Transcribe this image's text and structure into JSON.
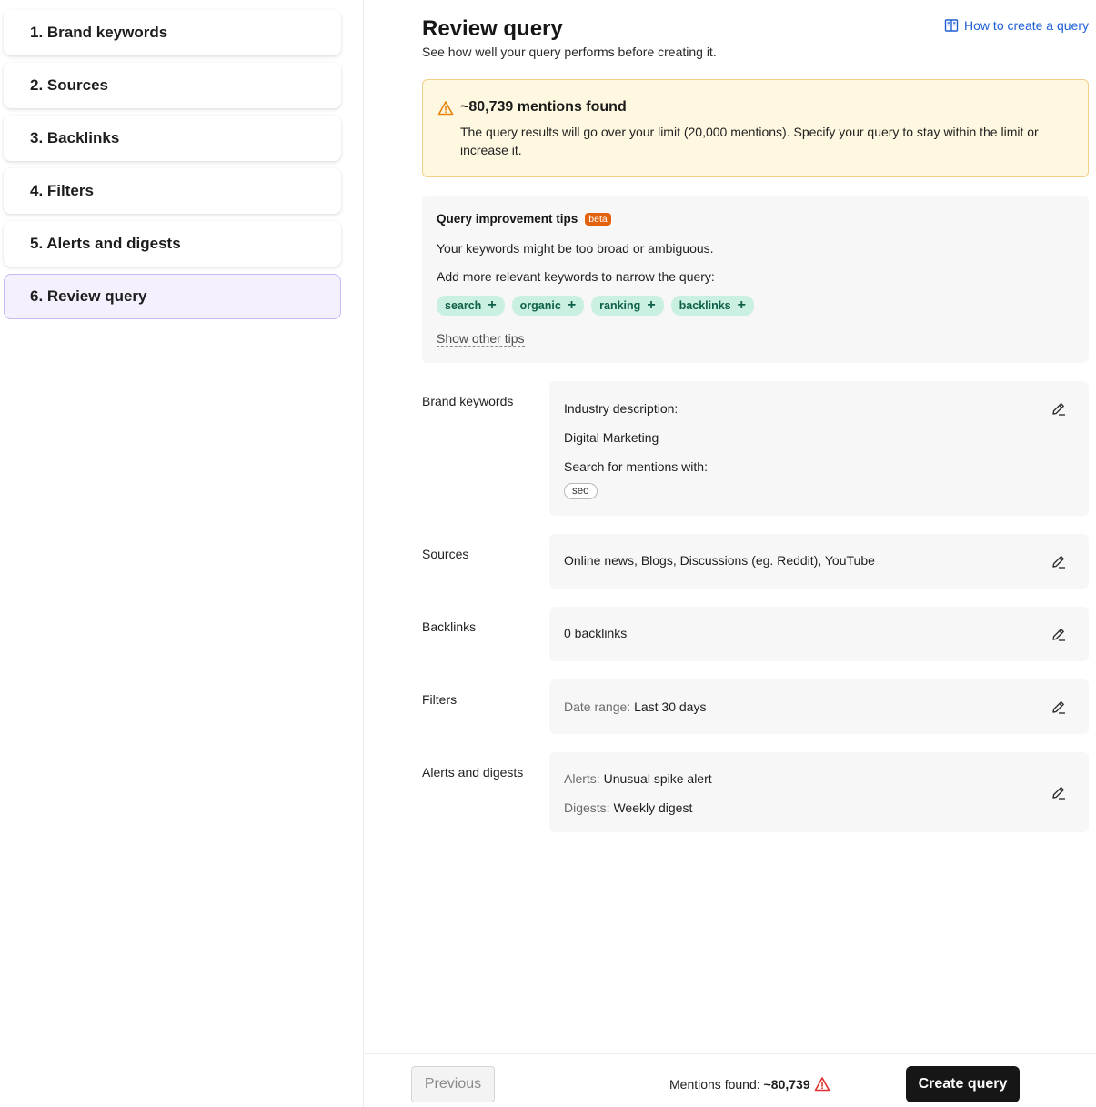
{
  "sidebar": {
    "steps": [
      {
        "label": "1. Brand keywords"
      },
      {
        "label": "2. Sources"
      },
      {
        "label": "3. Backlinks"
      },
      {
        "label": "4. Filters"
      },
      {
        "label": "5. Alerts and digests"
      },
      {
        "label": "6. Review query"
      }
    ],
    "active_step": 6
  },
  "header": {
    "title": "Review query",
    "subtitle": "See how well your query performs before creating it.",
    "help_link": "How to create a query",
    "help_icon": "book-icon"
  },
  "warning": {
    "icon": "warning-triangle-icon",
    "title": "~80,739 mentions found",
    "text": "The query results will go over your limit (20,000 mentions). Specify your query to stay within the limit or increase it."
  },
  "tips": {
    "title": "Query improvement tips",
    "badge": "beta",
    "line1": "Your keywords might be too broad or ambiguous.",
    "line2": "Add more relevant keywords to narrow the query:",
    "chips": [
      "search",
      "organic",
      "ranking",
      "backlinks"
    ],
    "chip_action": "+",
    "show_other": "Show other tips"
  },
  "summary": {
    "brand_keywords": {
      "label": "Brand keywords",
      "industry_label": "Industry description:",
      "industry_value": "Digital Marketing",
      "mentions_label": "Search for mentions with:",
      "keyword": "seo"
    },
    "sources": {
      "label": "Sources",
      "value": "Online news, Blogs, Discussions (eg. Reddit), YouTube"
    },
    "backlinks": {
      "label": "Backlinks",
      "value": "0 backlinks"
    },
    "filters": {
      "label": "Filters",
      "date_label": "Date range:",
      "date_value": "Last 30 days"
    },
    "alerts": {
      "label": "Alerts and digests",
      "alerts_label": "Alerts:",
      "alerts_value": "Unusual spike alert",
      "digests_label": "Digests:",
      "digests_value": "Weekly digest"
    },
    "edit_icon": "pencil-icon"
  },
  "footer": {
    "previous": "Previous",
    "mentions_label": "Mentions found:",
    "mentions_value": "~80,739",
    "create": "Create query"
  },
  "colors": {
    "accent_active_bg": "#f4f0fd",
    "accent_active_border": "#c9b6f2",
    "warning_bg": "#fff8e0",
    "warning_border": "#f0cf86",
    "warning_icon": "#e8830c",
    "chip_bg": "#c9f0e1",
    "chip_text": "#0f6048",
    "badge": "#e2620e",
    "link": "#1f5fd6",
    "error_icon": "#e03131"
  }
}
